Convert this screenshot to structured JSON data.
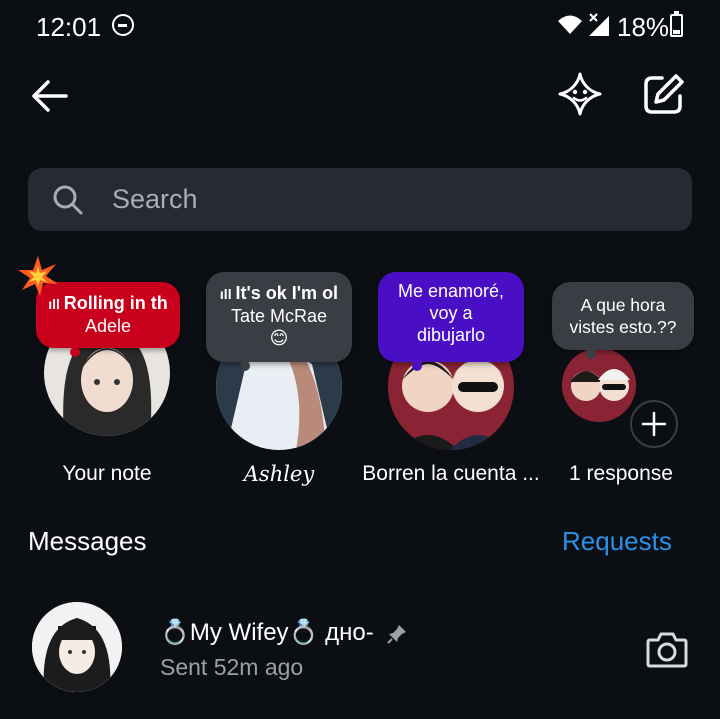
{
  "status_bar": {
    "time": "12:01",
    "battery": "18%",
    "icons": [
      "do-not-disturb-icon",
      "wifi-icon",
      "signal-icon",
      "battery-icon"
    ]
  },
  "header": {
    "icons": [
      "back-arrow-icon",
      "ai-sparkle-icon",
      "compose-icon"
    ]
  },
  "search": {
    "placeholder": "Search"
  },
  "notes": [
    {
      "bubble_line1": "Rolling in th",
      "bubble_line2": "Adele",
      "caption": "Your note",
      "bubble_color": "#c8001c",
      "has_music": true
    },
    {
      "bubble_line1": "It's ok I'm ol",
      "bubble_line2": "Tate McRae",
      "bubble_emoji": "😊",
      "caption": "Ashley",
      "bubble_color": "#3a3e44",
      "has_music": true
    },
    {
      "bubble_lines": [
        "Me enamoré,",
        "voy a",
        "dibujarlo"
      ],
      "caption": "Borren la cuenta ...",
      "bubble_color": "#4a0fc4"
    },
    {
      "bubble_lines": [
        "A que hora",
        "vistes esto.??"
      ],
      "caption": "1 response",
      "bubble_color": "#3a3e44",
      "add_icon": "plus-icon"
    }
  ],
  "messages": {
    "title": "Messages",
    "requests_label": "Requests"
  },
  "chats": [
    {
      "name": "💍My Wifey💍 дно-",
      "subtitle": "Sent 52m ago",
      "pinned": true,
      "action_icon": "camera-icon"
    }
  ],
  "colors": {
    "background": "#0b0f14",
    "search_bg": "#262b33",
    "accent": "#2a90e8",
    "muted_text": "#9aa0a6"
  }
}
